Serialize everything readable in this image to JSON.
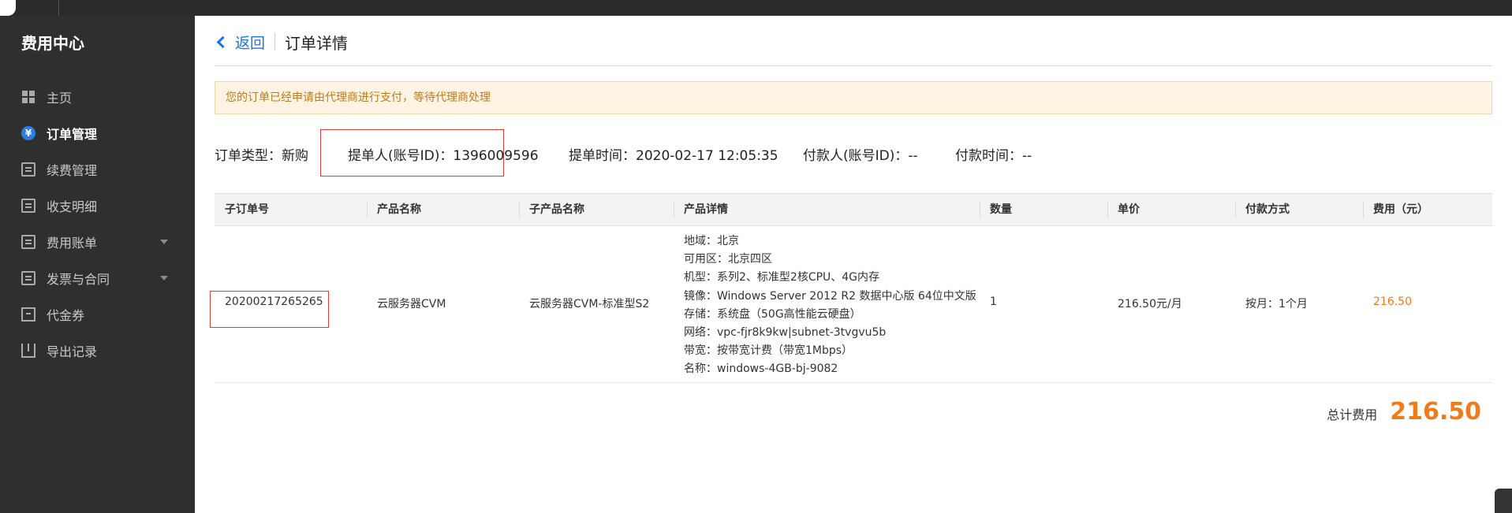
{
  "sidebar": {
    "title": "费用中心",
    "items": [
      {
        "label": "主页",
        "icon": "grid-icon"
      },
      {
        "label": "订单管理",
        "icon": "yuan-coin-icon",
        "active": true
      },
      {
        "label": "续费管理",
        "icon": "renew-doc-icon"
      },
      {
        "label": "收支明细",
        "icon": "ledger-icon"
      },
      {
        "label": "费用账单",
        "icon": "bill-icon",
        "expandable": true
      },
      {
        "label": "发票与合同",
        "icon": "invoice-icon",
        "expandable": true
      },
      {
        "label": "代金券",
        "icon": "voucher-icon"
      },
      {
        "label": "导出记录",
        "icon": "export-icon"
      }
    ]
  },
  "header": {
    "back_label": "返回",
    "title": "订单详情"
  },
  "notice": "您的订单已经申请由代理商进行支付，等待代理商处理",
  "order_info": {
    "type_label": "订单类型：",
    "type_value": "新购",
    "submitter_label": "提单人(账号ID)：",
    "submitter_value": "1396009596",
    "submit_time_label": "提单时间：",
    "submit_time_value": "2020-02-17 12:05:35",
    "payer_label": "付款人(账号ID)：",
    "payer_value": "--",
    "pay_time_label": "付款时间：",
    "pay_time_value": "--"
  },
  "table": {
    "columns": [
      "子订单号",
      "产品名称",
      "子产品名称",
      "产品详情",
      "数量",
      "单价",
      "付款方式",
      "费用（元）"
    ],
    "rows": [
      {
        "sub_order_no": "20200217265265",
        "product_name": "云服务器CVM",
        "sub_product_name": "云服务器CVM-标准型S2",
        "details": [
          "地域：北京",
          "可用区：北京四区",
          "机型：系列2、标准型2核CPU、4G内存",
          "镜像：Windows Server 2012 R2 数据中心版 64位中文版",
          "存储：系统盘（50G高性能云硬盘）",
          "网络：vpc-fjr8k9kw|subnet-3tvgvu5b",
          "带宽：按带宽计费（带宽1Mbps）",
          "名称：windows-4GB-bj-9082"
        ],
        "quantity": "1",
        "unit_price": "216.50元/月",
        "payment_method": "按月：1个月",
        "cost": "216.50"
      }
    ]
  },
  "total": {
    "label": "总计费用",
    "value": "216.50"
  },
  "colors": {
    "accent": "#1a73e8",
    "price": "#f07b1a",
    "highlight_box": "#e03a3a",
    "sidebar_bg": "#2f2f2f"
  }
}
